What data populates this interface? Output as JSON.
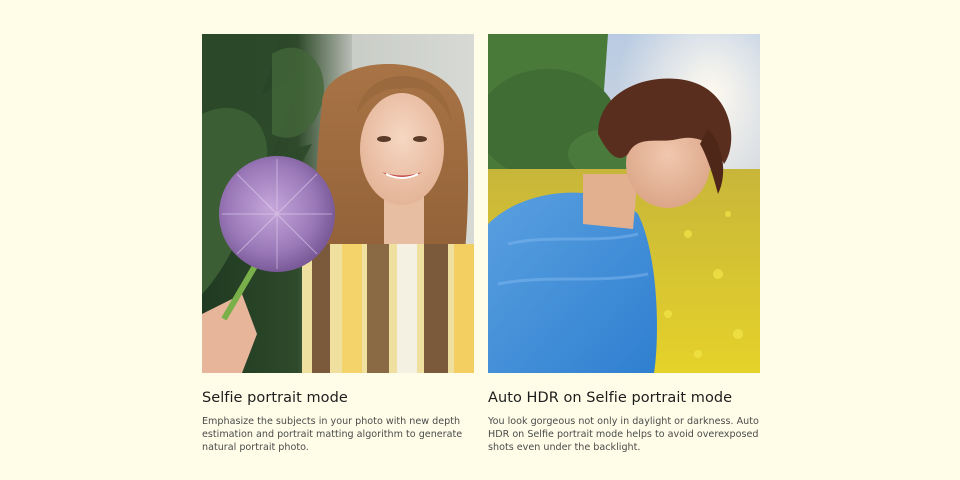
{
  "cards": [
    {
      "title": "Selfie portrait mode",
      "description": "Emphasize the subjects in your photo with new depth estimation and portrait matting algorithm to generate natural portrait photo."
    },
    {
      "title": "Auto HDR on Selfie portrait mode",
      "description": "You look gorgeous not only in daylight or darkness. Auto HDR on Selfie portrait mode helps to avoid overexposed shots even under the backlight."
    }
  ],
  "colors": {
    "background": "#fffde8",
    "title_text": "#1d1d1d",
    "body_text": "#4b4b4b"
  }
}
